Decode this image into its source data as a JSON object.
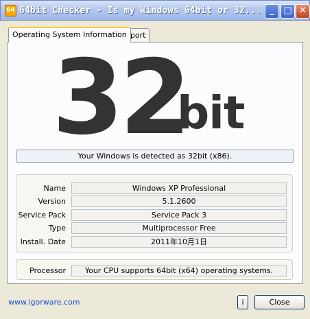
{
  "window": {
    "title": "64bit Checker - Is my Windows 64bit or 32...",
    "icon_label": "64",
    "minimize_glyph": "_",
    "maximize_glyph": "□",
    "close_glyph": "✕"
  },
  "tabs": [
    {
      "label": "Operating System Information",
      "selected": true
    },
    {
      "label": "Report",
      "selected": false
    }
  ],
  "result": {
    "number": "32",
    "unit": "bit",
    "detected_text": "Your Windows is detected as 32bit (x86)."
  },
  "system": {
    "rows": [
      {
        "label": "Name",
        "value": "Windows XP Professional"
      },
      {
        "label": "Version",
        "value": "5.1.2600"
      },
      {
        "label": "Service Pack",
        "value": "Service Pack 3"
      },
      {
        "label": "Type",
        "value": "Multiprocessor Free"
      },
      {
        "label": "Install. Date",
        "value": "2011年10月1日"
      }
    ]
  },
  "processor": {
    "label": "Processor",
    "value": "Your CPU supports 64bit (x64) operating systems."
  },
  "footer": {
    "link_text": "www.igorware.com",
    "info_label": "i",
    "close_label": "Close"
  },
  "colors": {
    "titlebar": "#9db6e8",
    "tab_highlight": "#ffc83c",
    "link": "#1a4fd6"
  }
}
